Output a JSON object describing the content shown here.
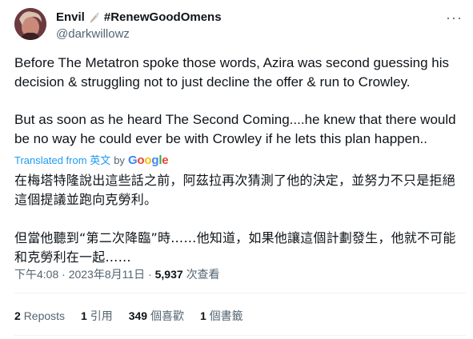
{
  "author": {
    "display_name": "Envil",
    "hashtag": "#RenewGoodOmens",
    "handle": "@darkwillowz"
  },
  "tweet": {
    "paragraph1": "Before The Metatron spoke those words, Azira was second guessing his decision & struggling not to just decline the offer & run to Crowley.",
    "paragraph2": "But as soon as he heard The Second Coming....he knew that there would be no way he could ever be with Crowley if he lets this plan happen.."
  },
  "translation": {
    "label": "Translated from",
    "source_language": "英文",
    "by": "by",
    "provider": "Google",
    "paragraph1": "在梅塔特隆說出這些話之前，阿茲拉再次猜測了他的決定，並努力不只是拒絕這個提議並跑向克勞利。",
    "paragraph2": "但當他聽到“第二次降臨”時……他知道，如果他讓這個計劃發生，他就不可能和克勞利在一起……"
  },
  "meta": {
    "time": "下午4:08",
    "separator": "·",
    "date": "2023年8月11日",
    "views_count": "5,937",
    "views_label": "次查看"
  },
  "stats": {
    "reposts_count": "2",
    "reposts_label": "Reposts",
    "quotes_count": "1",
    "quotes_label": "引用",
    "likes_count": "349",
    "likes_label": "個喜歡",
    "bookmarks_count": "1",
    "bookmarks_label": "個書籤"
  },
  "icons": {
    "more": "more-options-icon",
    "feather": "feather-emoji-icon"
  },
  "colors": {
    "link": "#1d9bf0",
    "secondary_text": "#536471",
    "primary_text": "#0f1419",
    "divider": "#eff3f4"
  }
}
